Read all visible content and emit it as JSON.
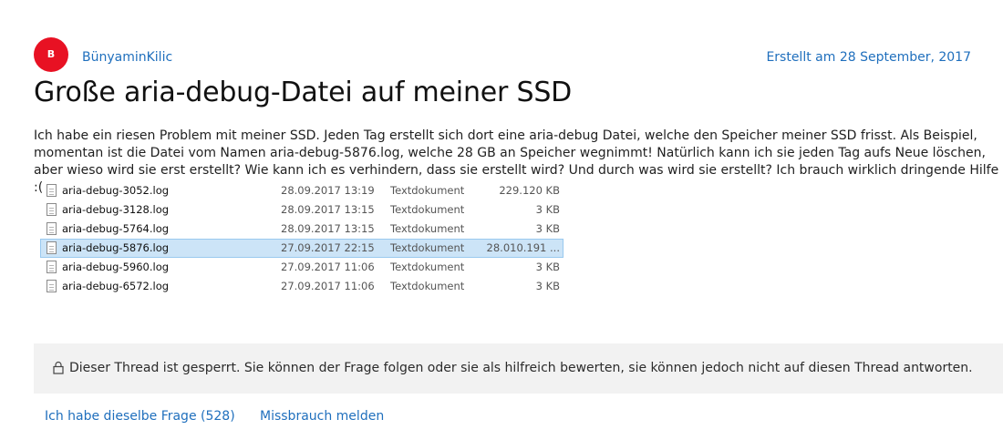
{
  "post": {
    "avatar_initial": "B",
    "avatar_color": "#e81123",
    "author": "BünyaminKilic",
    "created": "Erstellt am 28 September, 2017",
    "title": "Große aria-debug-Datei auf meiner SSD",
    "body": "Ich habe ein riesen Problem mit meiner SSD. Jeden Tag erstellt sich dort eine aria-debug Datei, welche den Speicher meiner SSD frisst. Als Beispiel, momentan ist die Datei vom Namen aria-debug-5876.log, welche 28 GB an Speicher wegnimmt! Natürlich kann ich sie jeden Tag aufs Neue löschen, aber wieso wird sie erst erstellt? Wie kann ich es verhindern, dass sie erstellt wird? Und durch was wird sie erstellt? Ich brauch wirklich dringende Hilfe :("
  },
  "files": [
    {
      "name": "aria-debug-3052.log",
      "date": "28.09.2017 13:19",
      "type": "Textdokument",
      "size": "229.120 KB",
      "selected": false
    },
    {
      "name": "aria-debug-3128.log",
      "date": "28.09.2017 13:15",
      "type": "Textdokument",
      "size": "3 KB",
      "selected": false
    },
    {
      "name": "aria-debug-5764.log",
      "date": "28.09.2017 13:15",
      "type": "Textdokument",
      "size": "3 KB",
      "selected": false
    },
    {
      "name": "aria-debug-5876.log",
      "date": "27.09.2017 22:15",
      "type": "Textdokument",
      "size": "28.010.191 ...",
      "selected": true
    },
    {
      "name": "aria-debug-5960.log",
      "date": "27.09.2017 11:06",
      "type": "Textdokument",
      "size": "3 KB",
      "selected": false
    },
    {
      "name": "aria-debug-6572.log",
      "date": "27.09.2017 11:06",
      "type": "Textdokument",
      "size": "3 KB",
      "selected": false
    }
  ],
  "notice": {
    "icon": "lock-icon",
    "text": "Dieser Thread ist gesperrt. Sie können der Frage folgen oder sie als hilfreich bewerten, sie können jedoch nicht auf diesen Thread antworten."
  },
  "actions": {
    "same_question": "Ich habe dieselbe Frage (528)",
    "report": "Missbrauch melden"
  },
  "colors": {
    "link": "#1f6fbd",
    "selection": "#cce4f7",
    "notice_bg": "#f2f2f2"
  }
}
